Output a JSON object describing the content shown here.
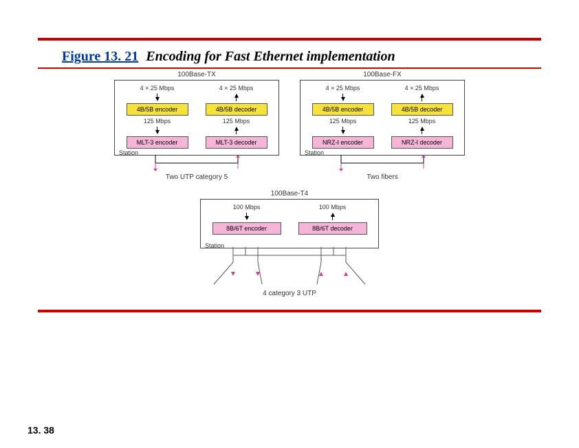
{
  "figure_number": "Figure 13. 21",
  "figure_title": "Encoding for Fast Ethernet implementation",
  "page_number": "13. 38",
  "panels": {
    "tx": {
      "title": "100Base-TX",
      "rate_in": "4 × 25 Mbps",
      "rate_mid": "125 Mbps",
      "encoder_top": "4B/5B encoder",
      "decoder_top": "4B/5B decoder",
      "encoder_bot": "MLT-3 encoder",
      "decoder_bot": "MLT-3 decoder",
      "station": "Station",
      "media": "Two UTP category 5"
    },
    "fx": {
      "title": "100Base-FX",
      "rate_in": "4 × 25 Mbps",
      "rate_mid": "125 Mbps",
      "encoder_top": "4B/5B encoder",
      "decoder_top": "4B/5B decoder",
      "encoder_bot": "NRZ-I encoder",
      "decoder_bot": "NRZ-I decoder",
      "station": "Station",
      "media": "Two fibers"
    },
    "t4": {
      "title": "100Base-T4",
      "rate_in": "100 Mbps",
      "encoder": "8B/6T encoder",
      "decoder": "8B/6T decoder",
      "station": "Station",
      "media": "4 category 3 UTP"
    }
  }
}
